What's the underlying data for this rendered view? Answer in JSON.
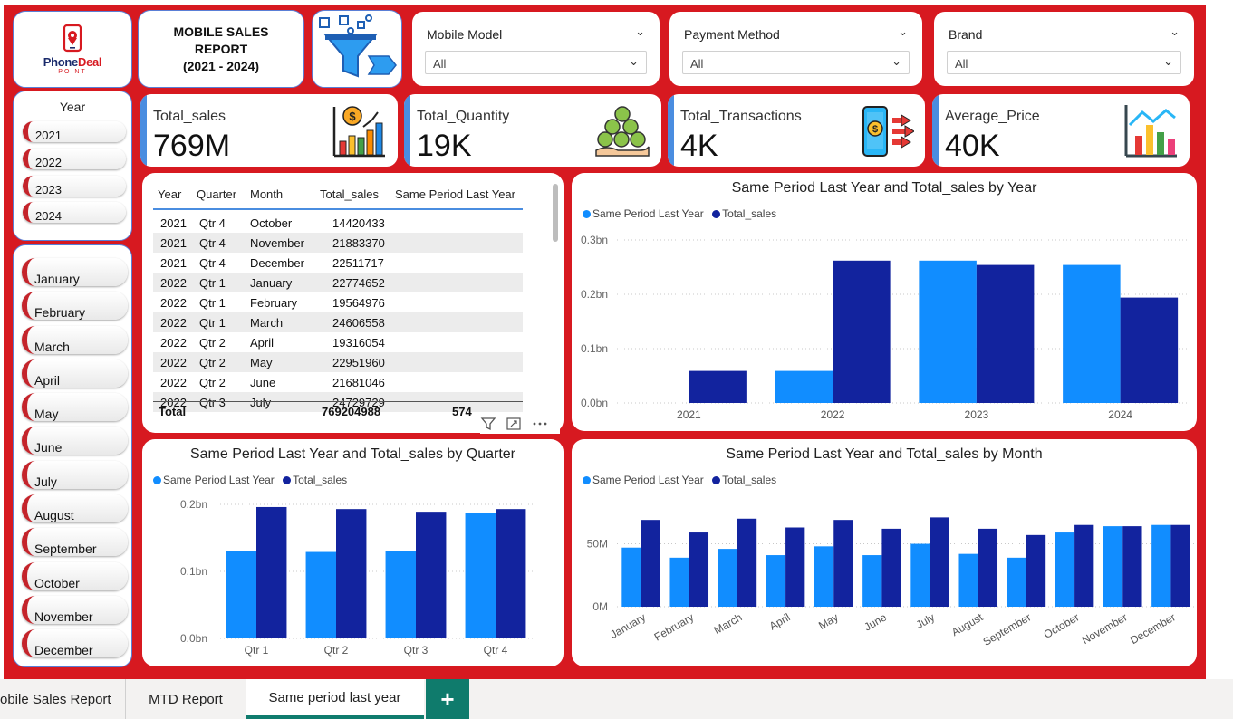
{
  "brand": {
    "name_part1": "Phone",
    "name_part2": "Deal",
    "sub": "POINT"
  },
  "report_title": {
    "line1": "MOBILE SALES",
    "line2": "REPORT",
    "line3": "(2021 - 2024)"
  },
  "slicers": [
    {
      "label": "Mobile Model",
      "value": "All"
    },
    {
      "label": "Payment Method",
      "value": "All"
    },
    {
      "label": "Brand",
      "value": "All"
    }
  ],
  "year_slicer": {
    "header": "Year",
    "items": [
      "2021",
      "2022",
      "2023",
      "2024"
    ]
  },
  "month_slicer": {
    "items": [
      "January",
      "February",
      "March",
      "April",
      "May",
      "June",
      "July",
      "August",
      "September",
      "October",
      "November",
      "December"
    ]
  },
  "kpis": [
    {
      "label": "Total_sales",
      "value": "769M",
      "icon": "sales-chart-icon"
    },
    {
      "label": "Total_Quantity",
      "value": "19K",
      "icon": "coins-hand-icon"
    },
    {
      "label": "Total_Transactions",
      "value": "4K",
      "icon": "phone-payment-icon"
    },
    {
      "label": "Average_Price",
      "value": "40K",
      "icon": "bar-trend-icon"
    }
  ],
  "table": {
    "headers": [
      "Year",
      "Quarter",
      "Month",
      "Total_sales",
      "Same Period Last Year"
    ],
    "rows": [
      [
        "2021",
        "Qtr 4",
        "October",
        "14420433",
        ""
      ],
      [
        "2021",
        "Qtr 4",
        "November",
        "21883370",
        ""
      ],
      [
        "2021",
        "Qtr 4",
        "December",
        "22511717",
        ""
      ],
      [
        "2022",
        "Qtr 1",
        "January",
        "22774652",
        ""
      ],
      [
        "2022",
        "Qtr 1",
        "February",
        "19564976",
        ""
      ],
      [
        "2022",
        "Qtr 1",
        "March",
        "24606558",
        ""
      ],
      [
        "2022",
        "Qtr 2",
        "April",
        "19316054",
        ""
      ],
      [
        "2022",
        "Qtr 2",
        "May",
        "22951960",
        ""
      ],
      [
        "2022",
        "Qtr 2",
        "June",
        "21681046",
        ""
      ],
      [
        "2022",
        "Qtr 3",
        "July",
        "24729729",
        ""
      ]
    ],
    "total_label": "Total",
    "total_sales": "769204988",
    "total_spl": "574"
  },
  "colors": {
    "spl": "#118dff",
    "total": "#12239e",
    "canvas": "#d71920"
  },
  "chart_data": [
    {
      "type": "bar",
      "title": "Same Period Last Year and Total_sales by Year",
      "categories": [
        "2021",
        "2022",
        "2023",
        "2024"
      ],
      "series": [
        {
          "name": "Same Period Last Year",
          "values": [
            0,
            0.059,
            0.262,
            0.254
          ]
        },
        {
          "name": "Total_sales",
          "values": [
            0.059,
            0.262,
            0.254,
            0.194
          ]
        }
      ],
      "yticks": [
        "0.0bn",
        "0.1bn",
        "0.2bn",
        "0.3bn"
      ],
      "ylim": [
        0,
        0.3
      ]
    },
    {
      "type": "bar",
      "title": "Same Period Last Year and Total_sales by Quarter",
      "categories": [
        "Qtr 1",
        "Qtr 2",
        "Qtr 3",
        "Qtr 4"
      ],
      "series": [
        {
          "name": "Same Period Last Year",
          "values": [
            0.131,
            0.129,
            0.131,
            0.187
          ]
        },
        {
          "name": "Total_sales",
          "values": [
            0.196,
            0.193,
            0.189,
            0.193
          ]
        }
      ],
      "yticks": [
        "0.0bn",
        "0.1bn",
        "0.2bn"
      ],
      "ylim": [
        0,
        0.2
      ]
    },
    {
      "type": "bar",
      "title": "Same Period Last Year and Total_sales by Month",
      "categories": [
        "January",
        "February",
        "March",
        "April",
        "May",
        "June",
        "July",
        "August",
        "September",
        "October",
        "November",
        "December"
      ],
      "series": [
        {
          "name": "Same Period Last Year",
          "values": [
            47,
            39,
            46,
            41,
            48,
            41,
            50,
            42,
            39,
            59,
            64,
            65
          ]
        },
        {
          "name": "Total_sales",
          "values": [
            69,
            59,
            70,
            63,
            69,
            62,
            71,
            62,
            57,
            65,
            64,
            65
          ]
        }
      ],
      "yticks": [
        "0M",
        "50M"
      ],
      "ylim": [
        0,
        90
      ]
    }
  ],
  "tabs": [
    "obile Sales Report",
    "MTD Report",
    "Same period last year"
  ],
  "add_tab": "+"
}
